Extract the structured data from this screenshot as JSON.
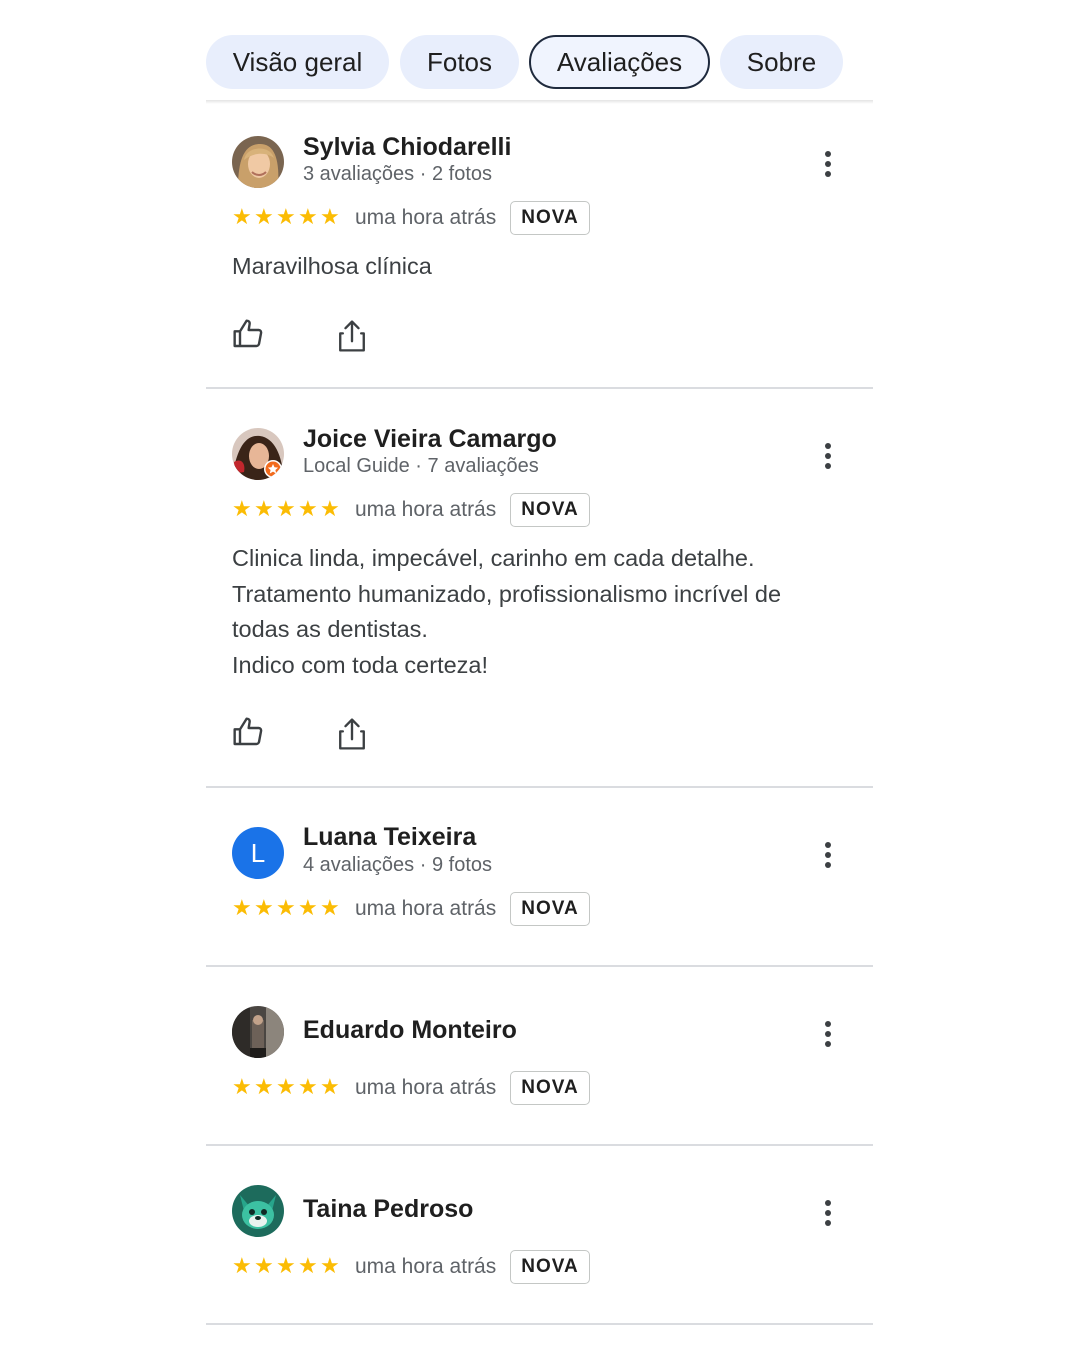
{
  "tabs": [
    {
      "label": "Visão geral",
      "active": false
    },
    {
      "label": "Fotos",
      "active": false
    },
    {
      "label": "Avaliações",
      "active": true
    },
    {
      "label": "Sobre",
      "active": false
    }
  ],
  "colors": {
    "star": "#fbbc04",
    "accent": "#1a73e8",
    "tab_bg": "#e8eefc"
  },
  "reviews": [
    {
      "name": "Sylvia Chiodarelli",
      "meta": "3 avaliações · 2 fotos",
      "rating": 5,
      "time": "uma hora atrás",
      "badge": "NOVA",
      "text": [
        "Maravilhosa clínica"
      ]
    },
    {
      "name": "Joice Vieira Camargo",
      "meta": "Local Guide · 7 avaliações",
      "rating": 5,
      "time": "uma hora atrás",
      "badge": "NOVA",
      "text": [
        "Clinica linda, impecável, carinho em cada detalhe.",
        "Tratamento humanizado, profissionalismo incrível de",
        "todas as dentistas.",
        "Indico com toda certeza!"
      ]
    },
    {
      "name": "Luana Teixeira",
      "avatar_letter": "L",
      "meta": "4 avaliações · 9 fotos",
      "rating": 5,
      "time": "uma hora atrás",
      "badge": "NOVA"
    },
    {
      "name": "Eduardo Monteiro",
      "rating": 5,
      "time": "uma hora atrás",
      "badge": "NOVA"
    },
    {
      "name": "Taina Pedroso",
      "rating": 5,
      "time": "uma hora atrás",
      "badge": "NOVA"
    }
  ],
  "icons": {
    "like": "thumbs-up-icon",
    "share": "share-icon",
    "menu": "more-vert-icon",
    "star": "star-icon"
  }
}
